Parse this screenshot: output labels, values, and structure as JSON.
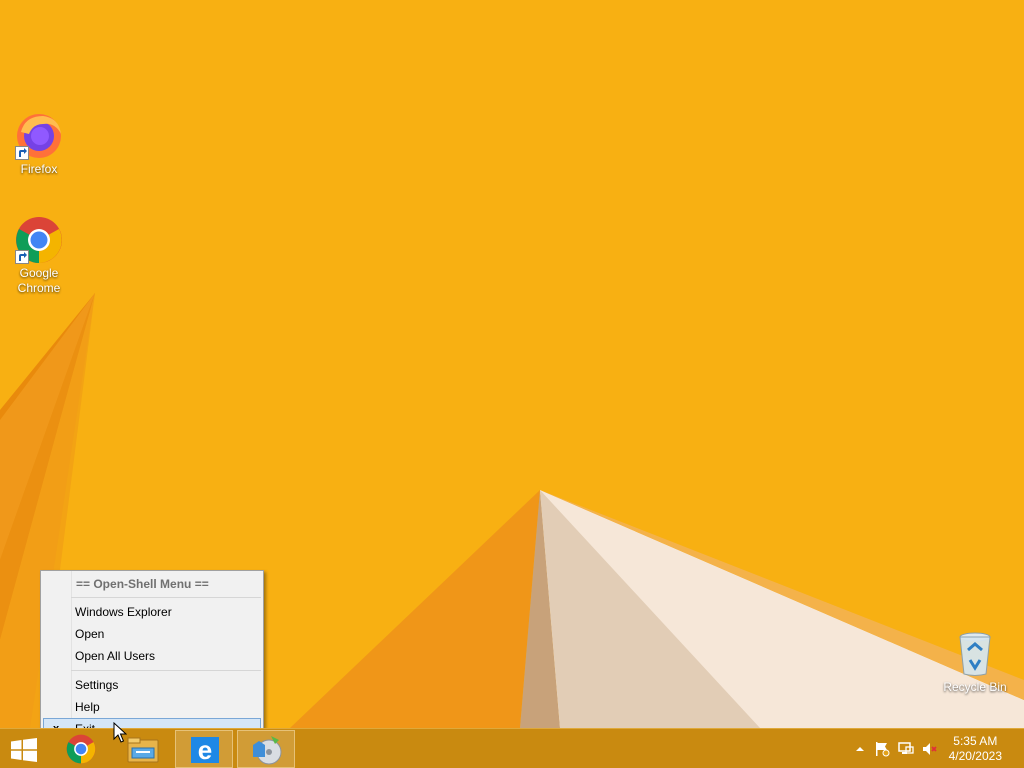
{
  "desktop": {
    "icons": [
      {
        "label": "Firefox",
        "icon": "firefox-icon"
      },
      {
        "label": "Google Chrome",
        "icon": "chrome-icon"
      },
      {
        "label": "Recycle Bin",
        "icon": "recycle-bin-icon"
      }
    ]
  },
  "menu": {
    "header": "== Open-Shell Menu ==",
    "items": [
      {
        "label": "Windows Explorer"
      },
      {
        "label": "Open"
      },
      {
        "label": "Open All Users"
      },
      {
        "label": "Settings"
      },
      {
        "label": "Help"
      },
      {
        "label": "Exit",
        "check": "x"
      }
    ]
  },
  "taskbar": {
    "start_icon": "windows-logo-icon",
    "pinned": [
      {
        "icon": "chrome-icon"
      },
      {
        "icon": "file-explorer-icon"
      },
      {
        "icon": "internet-explorer-icon"
      },
      {
        "icon": "media-player-icon"
      }
    ],
    "tray": {
      "icons": [
        "show-hidden-icons-chevron-icon",
        "action-center-flag-icon",
        "network-icon",
        "volume-muted-icon"
      ],
      "time": "5:35 AM",
      "date": "4/20/2023"
    }
  },
  "colors": {
    "wallpaper": "#f7ad10",
    "taskbar": "#c98a10",
    "menu_hover": "#d5e6f7"
  }
}
